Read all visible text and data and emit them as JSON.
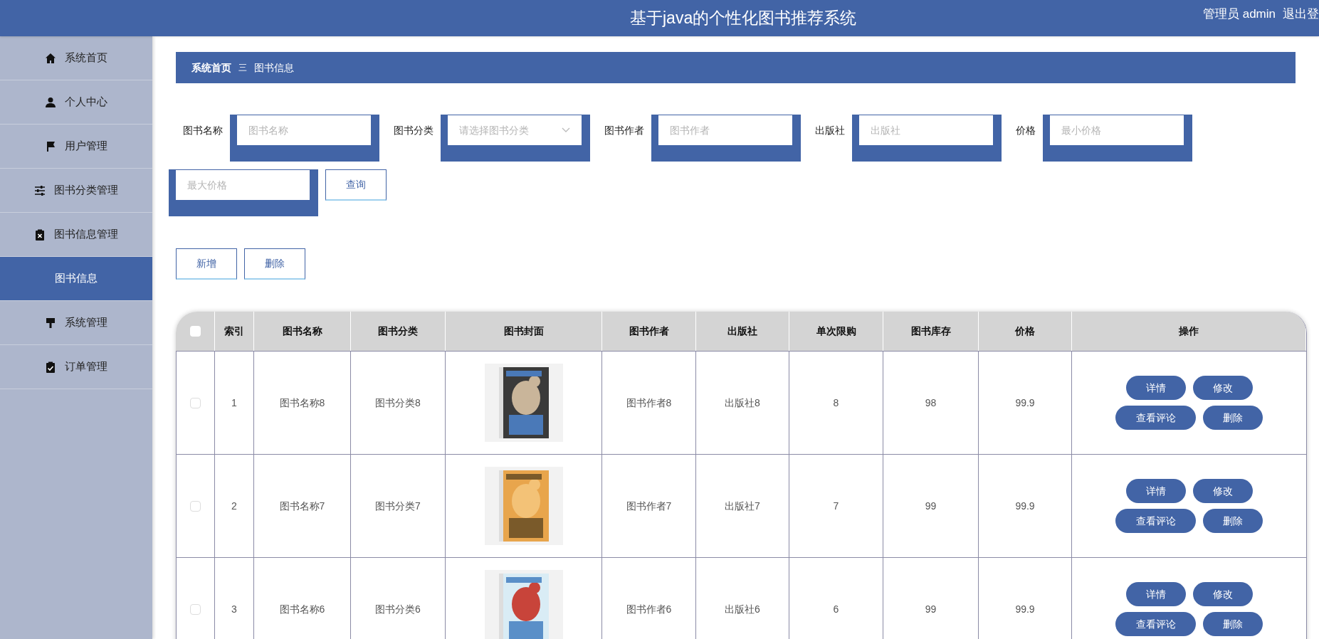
{
  "header": {
    "title": "基于java的个性化图书推荐系统",
    "user": "管理员 admin",
    "logout": "退出登"
  },
  "sidebar": {
    "items": [
      {
        "label": "系统首页",
        "selected": false
      },
      {
        "label": "个人中心",
        "selected": false
      },
      {
        "label": "用户管理",
        "selected": false
      },
      {
        "label": "图书分类管理",
        "selected": false
      },
      {
        "label": "图书信息管理",
        "selected": false,
        "children": [
          {
            "label": "图书信息",
            "selected": true
          }
        ]
      },
      {
        "label": "系统管理",
        "selected": false
      },
      {
        "label": "订单管理",
        "selected": false
      }
    ]
  },
  "breadcrumb": {
    "items": [
      "系统首页",
      "图书信息"
    ],
    "separator": "三"
  },
  "search": {
    "fields": [
      {
        "label": "图书名称",
        "placeholder": "图书名称",
        "kind": "input"
      },
      {
        "label": "图书分类",
        "placeholder": "请选择图书分类",
        "kind": "select"
      },
      {
        "label": "图书作者",
        "placeholder": "图书作者",
        "kind": "input"
      },
      {
        "label": "出版社",
        "placeholder": "出版社",
        "kind": "input"
      },
      {
        "label": "价格",
        "placeholder": "最小价格",
        "kind": "input"
      },
      {
        "placeholder": "最大价格",
        "kind": "input"
      }
    ],
    "button": "查询"
  },
  "actions": [
    "新增",
    "删除"
  ],
  "table": {
    "select_all": {
      "checked": false
    },
    "columns": [
      "索引",
      "图书名称",
      "图书分类",
      "图书封面",
      "图书作者",
      "出版社",
      "单次限购",
      "图书库存",
      "价格",
      "操作"
    ],
    "rows": [
      {
        "checked": false,
        "cells": [
          "1",
          "图书名称8",
          "图书分类8",
          {
            "kind": "picture"
          },
          "图书作者8",
          "出版社8",
          "8",
          "98",
          "99.9"
        ],
        "buttons": [
          "详情",
          "修改",
          "查看评论",
          "删除"
        ]
      },
      {
        "checked": false,
        "cells": [
          "2",
          "图书名称7",
          "图书分类7",
          {
            "kind": "picture"
          },
          "图书作者7",
          "出版社7",
          "7",
          "99",
          "99.9"
        ],
        "buttons": [
          "详情",
          "修改",
          "查看评论",
          "删除"
        ]
      },
      {
        "checked": false,
        "cells": [
          "3",
          "图书名称6",
          "图书分类6",
          {
            "kind": "picture"
          },
          "图书作者6",
          "出版社6",
          "6",
          "99",
          "99.9"
        ],
        "buttons": [
          "详情",
          "修改",
          "查看评论",
          "删除"
        ]
      }
    ]
  }
}
